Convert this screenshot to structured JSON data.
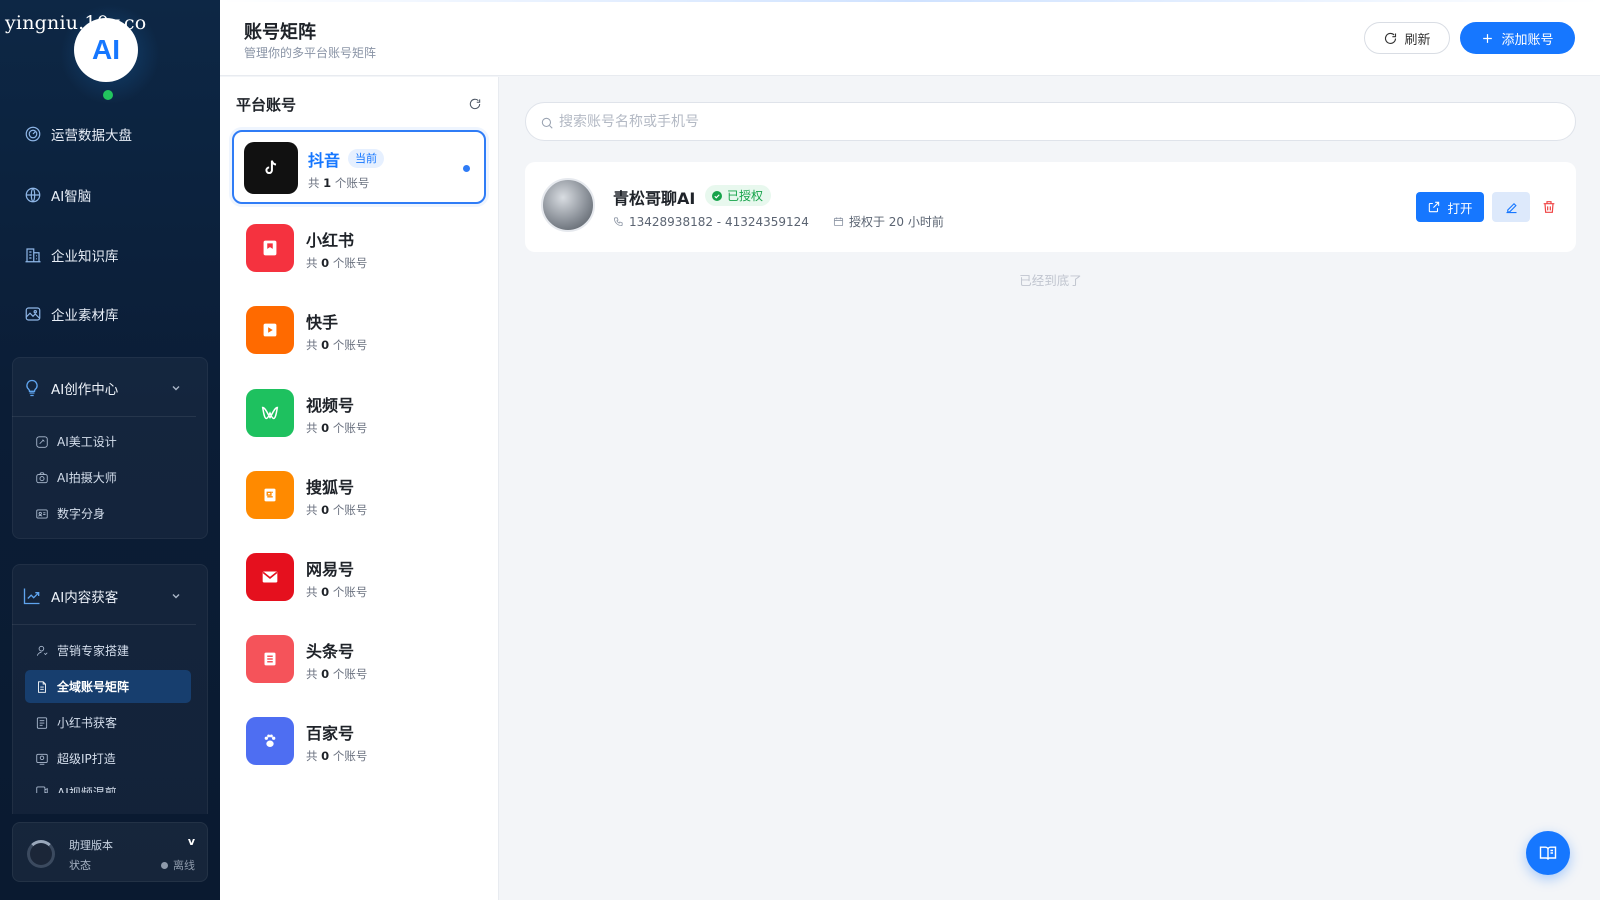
{
  "watermark": "yingniu.10v.co",
  "logo": {
    "text": "AI",
    "status_color": "#22c55e"
  },
  "sidebar": {
    "items": [
      {
        "label": "运营数据大盘",
        "icon": "gauge-icon"
      },
      {
        "label": "AI智脑",
        "icon": "globe-icon"
      },
      {
        "label": "企业知识库",
        "icon": "building-icon"
      },
      {
        "label": "企业素材库",
        "icon": "image-icon"
      }
    ],
    "groups": [
      {
        "label": "AI创作中心",
        "icon": "lightbulb-icon",
        "items": [
          {
            "label": "AI美工设计",
            "icon": "palette-icon"
          },
          {
            "label": "AI拍摄大师",
            "icon": "camera-icon"
          },
          {
            "label": "数字分身",
            "icon": "id-card-icon"
          }
        ]
      },
      {
        "label": "AI内容获客",
        "icon": "trend-icon",
        "items": [
          {
            "label": "营销专家搭建",
            "icon": "user-icon"
          },
          {
            "label": "全域账号矩阵",
            "icon": "document-icon",
            "active": true
          },
          {
            "label": "小红书获客",
            "icon": "book-icon"
          },
          {
            "label": "超级IP打造",
            "icon": "badge-icon"
          },
          {
            "label": "AI视频混剪",
            "icon": "video-icon"
          }
        ]
      }
    ],
    "version": {
      "title": "助理版本",
      "v": "v",
      "status_label": "状态",
      "status_value": "离线"
    }
  },
  "header": {
    "title": "账号矩阵",
    "subtitle": "管理你的多平台账号矩阵",
    "refresh_label": "刷新",
    "add_label": "添加账号"
  },
  "platforms": {
    "title": "平台账号",
    "current_badge": "当前",
    "items": [
      {
        "name": "抖音",
        "count_prefix": "共",
        "count": "1",
        "count_suffix": "个账号",
        "color": "#111111",
        "icon": "tiktok-icon",
        "current": true
      },
      {
        "name": "小红书",
        "count_prefix": "共",
        "count": "0",
        "count_suffix": "个账号",
        "color": "#f5323f",
        "icon": "xiaohongshu-icon"
      },
      {
        "name": "快手",
        "count_prefix": "共",
        "count": "0",
        "count_suffix": "个账号",
        "color": "#ff6a00",
        "icon": "kuaishou-play-icon"
      },
      {
        "name": "视频号",
        "count_prefix": "共",
        "count": "0",
        "count_suffix": "个账号",
        "color": "#1ec15f",
        "icon": "channels-butterfly-icon"
      },
      {
        "name": "搜狐号",
        "count_prefix": "共",
        "count": "0",
        "count_suffix": "个账号",
        "color": "#ff8a00",
        "icon": "sohu-doc-icon"
      },
      {
        "name": "网易号",
        "count_prefix": "共",
        "count": "0",
        "count_suffix": "个账号",
        "color": "#e5101e",
        "icon": "mail-icon"
      },
      {
        "name": "头条号",
        "count_prefix": "共",
        "count": "0",
        "count_suffix": "个账号",
        "color": "#f5535a",
        "icon": "news-icon"
      },
      {
        "name": "百家号",
        "count_prefix": "共",
        "count": "0",
        "count_suffix": "个账号",
        "color": "#4e6ef2",
        "icon": "paw-icon"
      }
    ]
  },
  "search": {
    "placeholder": "搜索账号名称或手机号"
  },
  "account": {
    "name": "青松哥聊AI",
    "status": "已授权",
    "phone": "13428938182 - 41324359124",
    "auth_time": "授权于 20 小时前",
    "open_label": "打开"
  },
  "list_end_text": "已经到底了",
  "colors": {
    "primary": "#1677ff",
    "success": "#16a34a",
    "danger": "#ef4444",
    "sidebar_bg": "#0b1d36"
  }
}
